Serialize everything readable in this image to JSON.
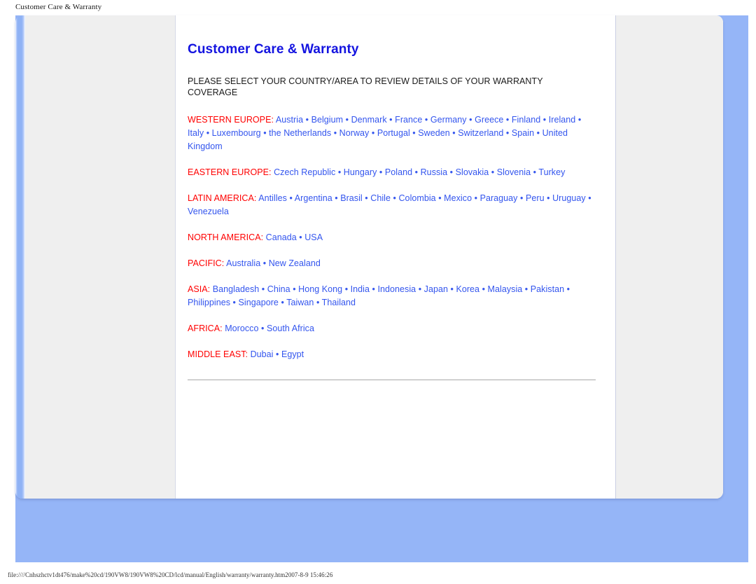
{
  "browser": {
    "document_title": "Customer Care & Warranty",
    "status_url": "file:////Cnhszhctv1dt476/make%20cd/190VW8/190VW8%20CD/lcd/manual/English/warranty/warranty.htm2007-8-9 15:46:26"
  },
  "colors": {
    "heading_blue": "#1414E0",
    "link_blue": "#3355EE",
    "region_red": "#FF0000",
    "page_backdrop_blue": "#95B5F7",
    "sidebar_gray": "#EFEFEF",
    "accent_stripe_blue": "#8FB2F5",
    "divider_gray": "#A9A9A9"
  },
  "content": {
    "title": "Customer Care & Warranty",
    "intro": "PLEASE SELECT YOUR COUNTRY/AREA TO REVIEW DETAILS OF YOUR WARRANTY COVERAGE",
    "separator": "•",
    "regions": [
      {
        "label": "WESTERN EUROPE:",
        "countries": [
          "Austria",
          "Belgium",
          "Denmark",
          "France",
          "Germany",
          "Greece",
          "Finland",
          "Ireland",
          "Italy",
          "Luxembourg",
          "the Netherlands",
          "Norway",
          "Portugal",
          "Sweden",
          "Switzerland",
          "Spain",
          "United Kingdom"
        ]
      },
      {
        "label": "EASTERN EUROPE:",
        "countries": [
          "Czech Republic",
          "Hungary",
          "Poland",
          "Russia",
          "Slovakia",
          "Slovenia",
          "Turkey"
        ]
      },
      {
        "label": "LATIN AMERICA:",
        "countries": [
          "Antilles",
          "Argentina",
          "Brasil",
          "Chile",
          "Colombia",
          "Mexico",
          "Paraguay",
          "Peru",
          "Uruguay",
          "Venezuela"
        ]
      },
      {
        "label": "NORTH AMERICA:",
        "countries": [
          "Canada",
          "USA"
        ]
      },
      {
        "label": "PACIFIC:",
        "countries": [
          "Australia",
          "New Zealand"
        ]
      },
      {
        "label": "ASIA:",
        "countries": [
          "Bangladesh",
          "China",
          "Hong Kong",
          "India",
          "Indonesia",
          "Japan",
          "Korea",
          "Malaysia",
          "Pakistan",
          "Philippines",
          "Singapore",
          "Taiwan",
          "Thailand"
        ]
      },
      {
        "label": "AFRICA:",
        "countries": [
          "Morocco",
          "South Africa"
        ]
      },
      {
        "label": "MIDDLE EAST:",
        "countries": [
          "Dubai",
          "Egypt"
        ]
      }
    ]
  }
}
